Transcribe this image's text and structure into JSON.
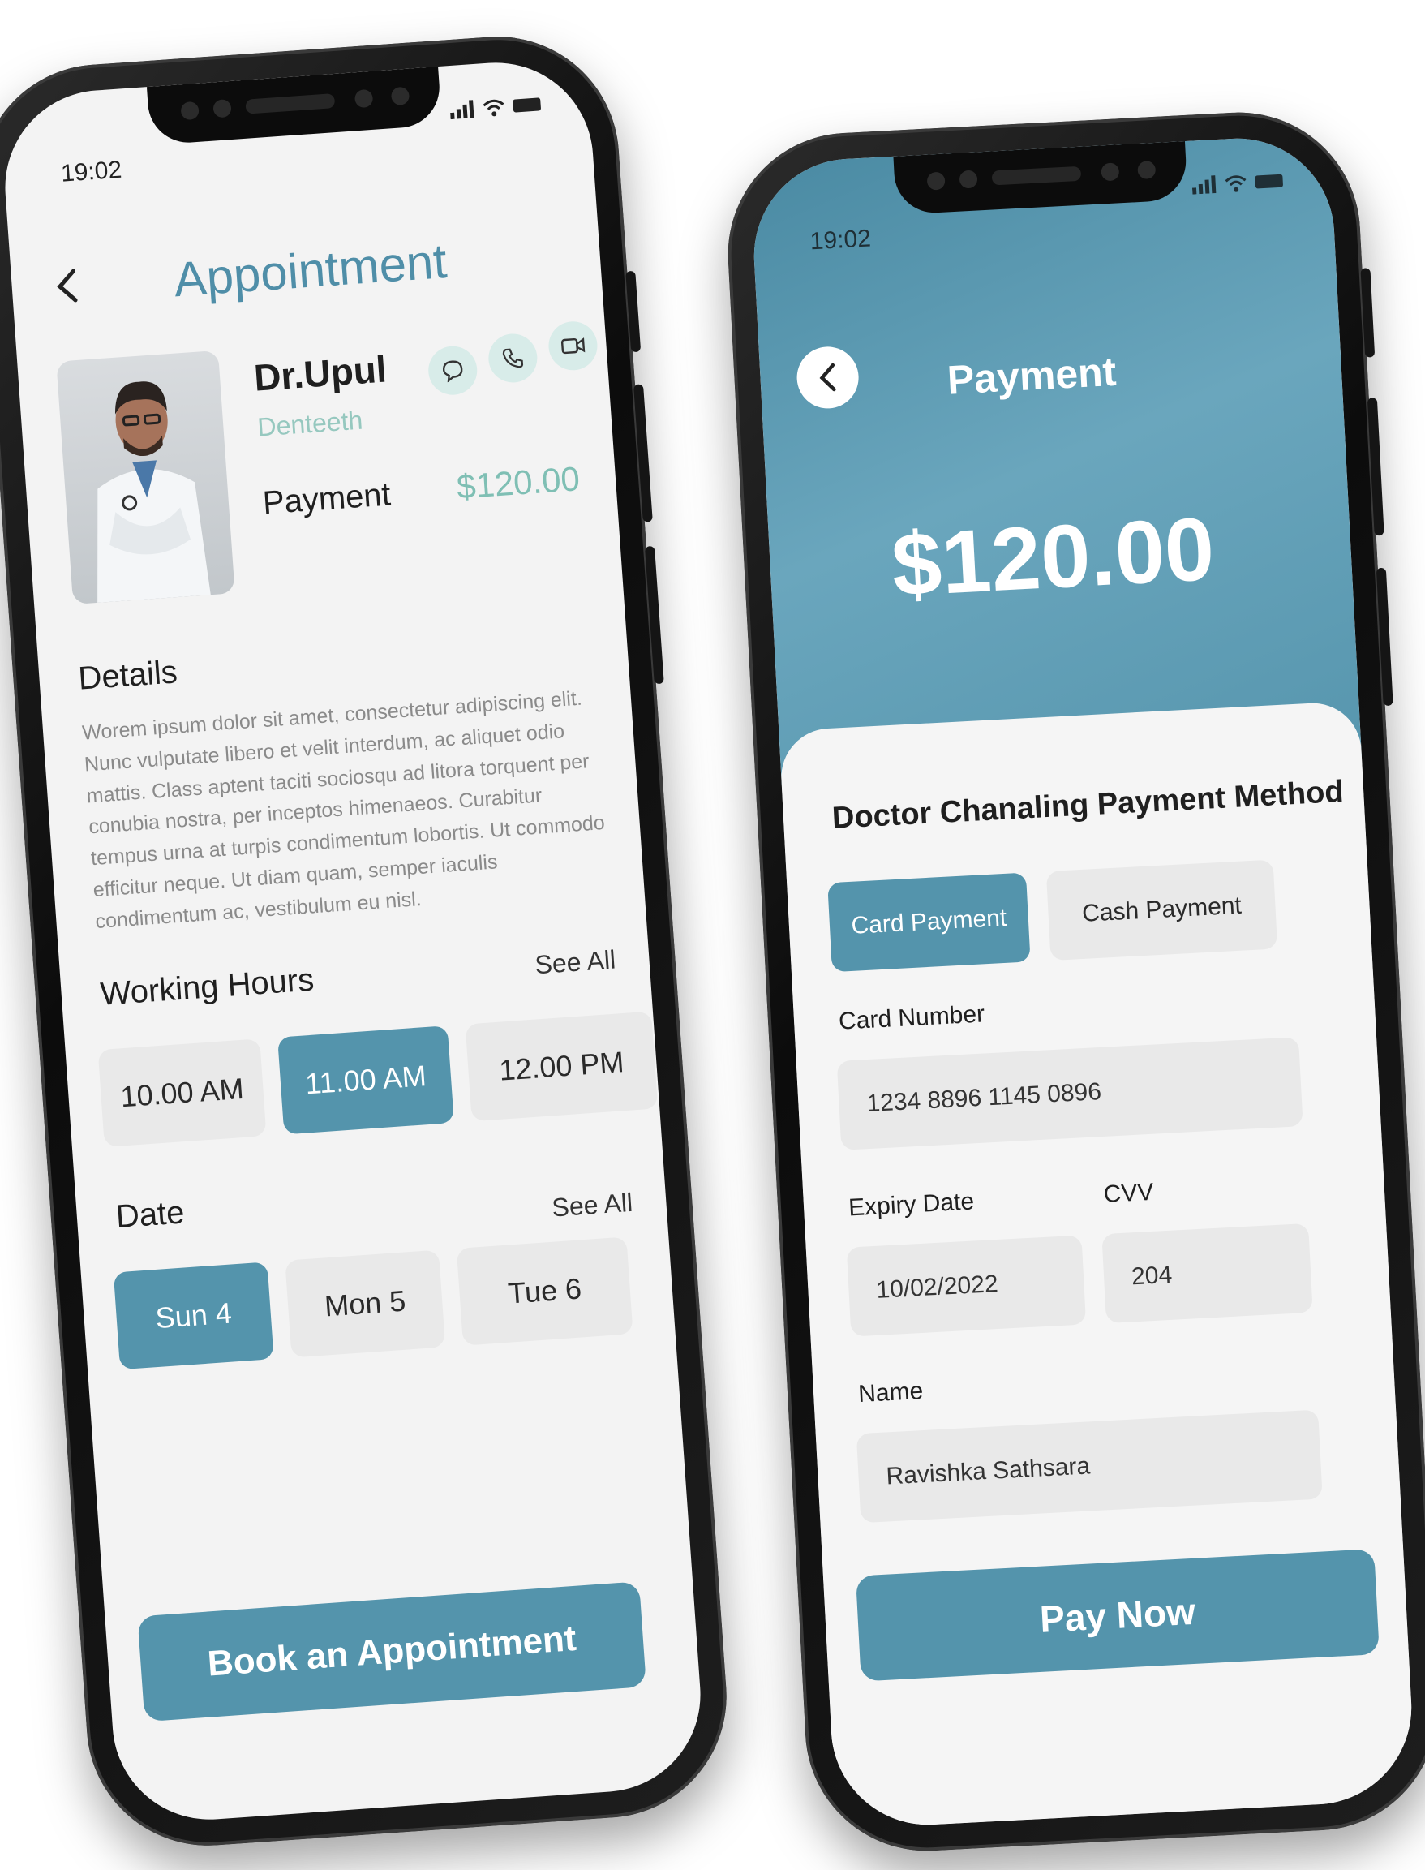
{
  "appointment_screen": {
    "status_time": "19:02",
    "title": "Appointment",
    "doctor": {
      "name": "Dr.Upul",
      "specialty": "Denteeth",
      "payment_label": "Payment",
      "payment_value": "$120.00"
    },
    "details_title": "Details",
    "details_text": "Worem ipsum dolor sit amet, consectetur adipiscing elit. Nunc vulputate libero et velit interdum, ac aliquet odio mattis. Class aptent taciti sociosqu ad litora torquent per conubia nostra, per inceptos himenaeos. Curabitur tempus urna at turpis condimentum lobortis. Ut commodo efficitur neque. Ut diam quam, semper iaculis condimentum ac, vestibulum eu nisl.",
    "working_hours_title": "Working Hours",
    "working_hours_see_all": "See All",
    "working_hours": [
      "10.00 AM",
      "11.00 AM",
      "12.00 PM"
    ],
    "selected_hour": "11.00 AM",
    "date_title": "Date",
    "date_see_all": "See All",
    "dates": [
      "Sun 4",
      "Mon 5",
      "Tue 6"
    ],
    "selected_date": "Sun 4",
    "book_button": "Book an Appointment"
  },
  "payment_screen": {
    "status_time": "19:02",
    "title": "Payment",
    "amount": "$120.00",
    "method_title": "Doctor Chanaling Payment Method",
    "methods": [
      "Card Payment",
      "Cash Payment"
    ],
    "selected_method": "Card Payment",
    "card_number_label": "Card Number",
    "card_number_value": "1234 8896 1145 0896",
    "expiry_label": "Expiry Date",
    "expiry_value": "10/02/2022",
    "cvv_label": "CVV",
    "cvv_value": "204",
    "name_label": "Name",
    "name_value": "Ravishka Sathsara",
    "pay_button": "Pay Now"
  },
  "colors": {
    "accent": "#5494ac",
    "title_teal": "#4f8ea8",
    "mint": "#96c8bf",
    "chip_bg": "#e9e9e9"
  },
  "icons": {
    "chat": "chat-icon",
    "phone": "phone-icon",
    "video": "video-icon",
    "back": "chevron-left-icon"
  }
}
